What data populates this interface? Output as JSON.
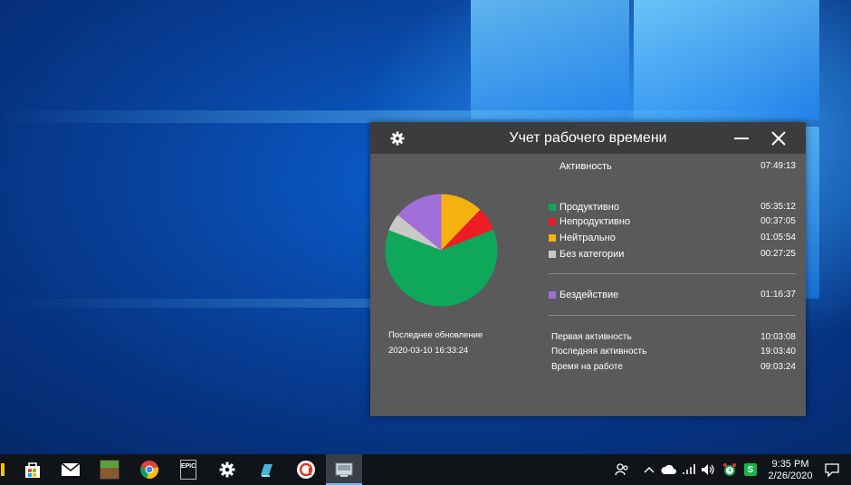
{
  "window": {
    "title": "Учет рабочего времени",
    "settings_icon": "gear-icon",
    "minimize_icon": "minimize-icon",
    "close_icon": "close-icon"
  },
  "summary": {
    "activity_label": "Активность",
    "activity_value": "07:49:13"
  },
  "categories": [
    {
      "label": "Продуктивно",
      "value": "05:35:12",
      "color": "#0fa85a"
    },
    {
      "label": "Непродуктивно",
      "value": "00:37:05",
      "color": "#ee1c24"
    },
    {
      "label": "Нейтрально",
      "value": "01:05:54",
      "color": "#f5b20f"
    },
    {
      "label": "Без категории",
      "value": "00:27:25",
      "color": "#c8c8c8"
    }
  ],
  "idle": {
    "label": "Бездействие",
    "value": "01:16:37",
    "color": "#a070d8"
  },
  "times": [
    {
      "label": "Первая активность",
      "value": "10:03:08"
    },
    {
      "label": "Последняя активность",
      "value": "19:03:40"
    },
    {
      "label": "Время на работе",
      "value": "09:03:24"
    }
  ],
  "last_update": {
    "label": "Последнее обновление",
    "value": "2020-03-10 16:33:24"
  },
  "chart_data": {
    "type": "pie",
    "slices": [
      {
        "label": "Нейтрально",
        "seconds": 3954,
        "color": "#f5b20f"
      },
      {
        "label": "Непродуктивно",
        "seconds": 2225,
        "color": "#ee1c24"
      },
      {
        "label": "Продуктивно",
        "seconds": 20112,
        "color": "#0fa85a"
      },
      {
        "label": "Без категории",
        "seconds": 1645,
        "color": "#c8c8c8"
      },
      {
        "label": "Бездействие",
        "seconds": 4597,
        "color": "#a070d8"
      }
    ]
  },
  "taskbar": {
    "apps": [
      "store-icon",
      "mail-icon",
      "minecraft-icon",
      "chrome-icon",
      "epic-games-icon",
      "settings-icon",
      "notepad-icon",
      "app-icon",
      "time-tracker-icon"
    ],
    "epic_label": "EPIC",
    "clock_time": "9:35 PM",
    "clock_date": "2/26/2020"
  }
}
